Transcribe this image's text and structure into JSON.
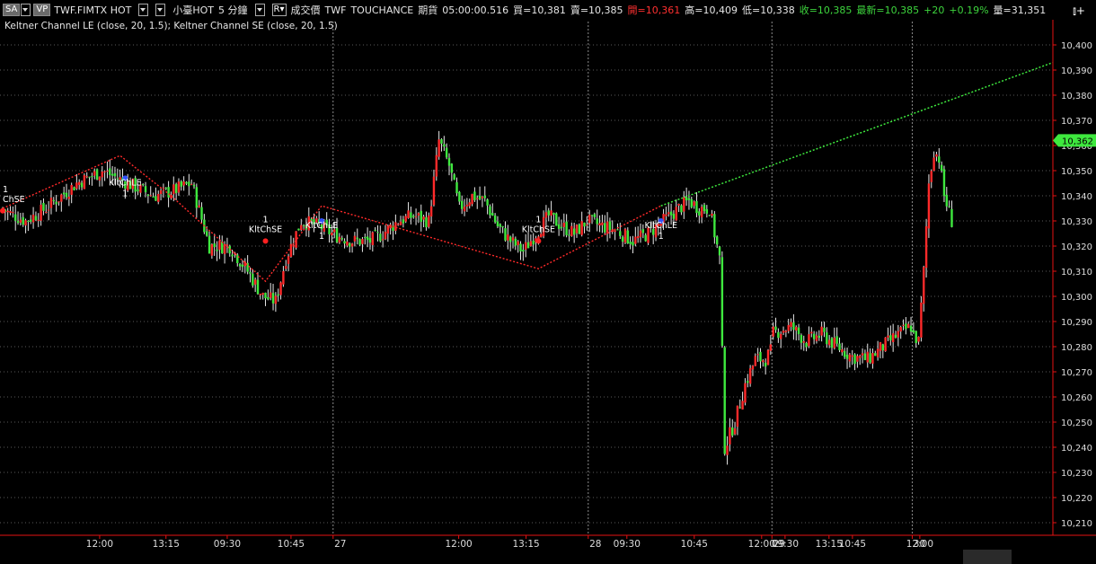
{
  "header": {
    "mode_label": "SA",
    "vp_label": "VP",
    "symbol": "TWF.FIMTX HOT",
    "product": "小臺HOT",
    "interval": "5 分鐘",
    "price_type": "成交價",
    "exchange": "TWF",
    "source": "TOUCHANCE",
    "category": "期貨",
    "time": "05:00:00.516",
    "bid": "買=10,381",
    "ask": "賣=10,385",
    "open": "開=10,361",
    "high": "高=10,409",
    "low": "低=10,338",
    "close": "收=10,385",
    "last": "最新=10,385",
    "change": "+20",
    "change_pct": "+0.19%",
    "volume": "量=31,351"
  },
  "indicator_legend": "Keltner Channel LE (close,  20,  1.5); Keltner Channel SE (close,  20,  1.5)",
  "colors": {
    "up": "#ff2a2a",
    "down": "#3ee83e",
    "axis": "#e31212",
    "grid": "#5a5a5a",
    "last_tag": "#3ee83e",
    "zigzag": "#ff2a2a",
    "trend": "#3ee83e"
  },
  "chart_data": {
    "type": "candlestick",
    "ylim": [
      10205,
      10405
    ],
    "y_ticks": [
      10210,
      10220,
      10230,
      10240,
      10250,
      10260,
      10270,
      10280,
      10290,
      10300,
      10310,
      10320,
      10330,
      10340,
      10350,
      10360,
      10370,
      10380,
      10390,
      10400
    ],
    "last_price": "10,362",
    "last_price_value": 10362,
    "x_labels": [
      "12:00",
      "13:15",
      "27",
      "09:30",
      "10:45",
      "12:00",
      "13:15",
      "28",
      "09:30",
      "10:45",
      "12:00",
      "13:15",
      "29",
      "09:30",
      "10:45",
      "12:00",
      "30"
    ],
    "day_separators": [
      "27",
      "28",
      "29",
      "30"
    ],
    "markers": [
      {
        "label": "ChSE",
        "count": "1",
        "type": "SE"
      },
      {
        "label": "KltChLE",
        "count": "1",
        "type": "LE"
      },
      {
        "label": "KltChSE",
        "count": "1",
        "type": "SE"
      },
      {
        "label": "KltChLE",
        "count": "1",
        "type": "LE"
      },
      {
        "label": "KltChSE",
        "count": "1",
        "type": "SE"
      },
      {
        "label": "KltChLE",
        "count": "1",
        "type": "LE"
      }
    ],
    "segments": [
      {
        "bars": 130,
        "anchors": [
          [
            0,
            10335
          ],
          [
            10,
            10330
          ],
          [
            18,
            10335
          ],
          [
            30,
            10345
          ],
          [
            40,
            10350
          ],
          [
            50,
            10345
          ],
          [
            60,
            10340
          ],
          [
            68,
            10342
          ],
          [
            75,
            10345
          ],
          [
            82,
            10320
          ],
          [
            90,
            10320
          ],
          [
            97,
            10310
          ],
          [
            103,
            10300
          ],
          [
            108,
            10298
          ],
          [
            112,
            10315
          ],
          [
            118,
            10330
          ],
          [
            125,
            10328
          ],
          [
            130,
            10325
          ]
        ]
      },
      {
        "bars": 100,
        "anchors": [
          [
            0,
            10325
          ],
          [
            8,
            10322
          ],
          [
            15,
            10322
          ],
          [
            20,
            10325
          ],
          [
            26,
            10330
          ],
          [
            32,
            10332
          ],
          [
            38,
            10330
          ],
          [
            42,
            10362
          ],
          [
            46,
            10352
          ],
          [
            50,
            10335
          ],
          [
            55,
            10340
          ],
          [
            60,
            10338
          ],
          [
            65,
            10328
          ],
          [
            70,
            10322
          ],
          [
            75,
            10318
          ],
          [
            80,
            10325
          ],
          [
            85,
            10332
          ],
          [
            90,
            10328
          ],
          [
            95,
            10325
          ],
          [
            100,
            10330
          ]
        ]
      },
      {
        "bars": 72,
        "anchors": [
          [
            0,
            10330
          ],
          [
            6,
            10328
          ],
          [
            12,
            10326
          ],
          [
            18,
            10322
          ],
          [
            24,
            10325
          ],
          [
            30,
            10330
          ],
          [
            36,
            10335
          ],
          [
            40,
            10338
          ],
          [
            44,
            10335
          ],
          [
            48,
            10335
          ],
          [
            52,
            10315
          ],
          [
            54,
            10240
          ],
          [
            58,
            10250
          ],
          [
            62,
            10265
          ],
          [
            66,
            10275
          ],
          [
            70,
            10275
          ],
          [
            72,
            10278
          ]
        ]
      },
      {
        "bars": 55,
        "anchors": [
          [
            0,
            10285
          ],
          [
            8,
            10288
          ],
          [
            14,
            10282
          ],
          [
            20,
            10285
          ],
          [
            26,
            10280
          ],
          [
            32,
            10276
          ],
          [
            38,
            10275
          ],
          [
            44,
            10280
          ],
          [
            50,
            10285
          ],
          [
            55,
            10288
          ]
        ]
      },
      {
        "bars": 16,
        "anchors": [
          [
            0,
            10286
          ],
          [
            3,
            10282
          ],
          [
            5,
            10310
          ],
          [
            7,
            10345
          ],
          [
            9,
            10358
          ],
          [
            11,
            10355
          ],
          [
            13,
            10340
          ],
          [
            16,
            10330
          ]
        ]
      }
    ]
  }
}
